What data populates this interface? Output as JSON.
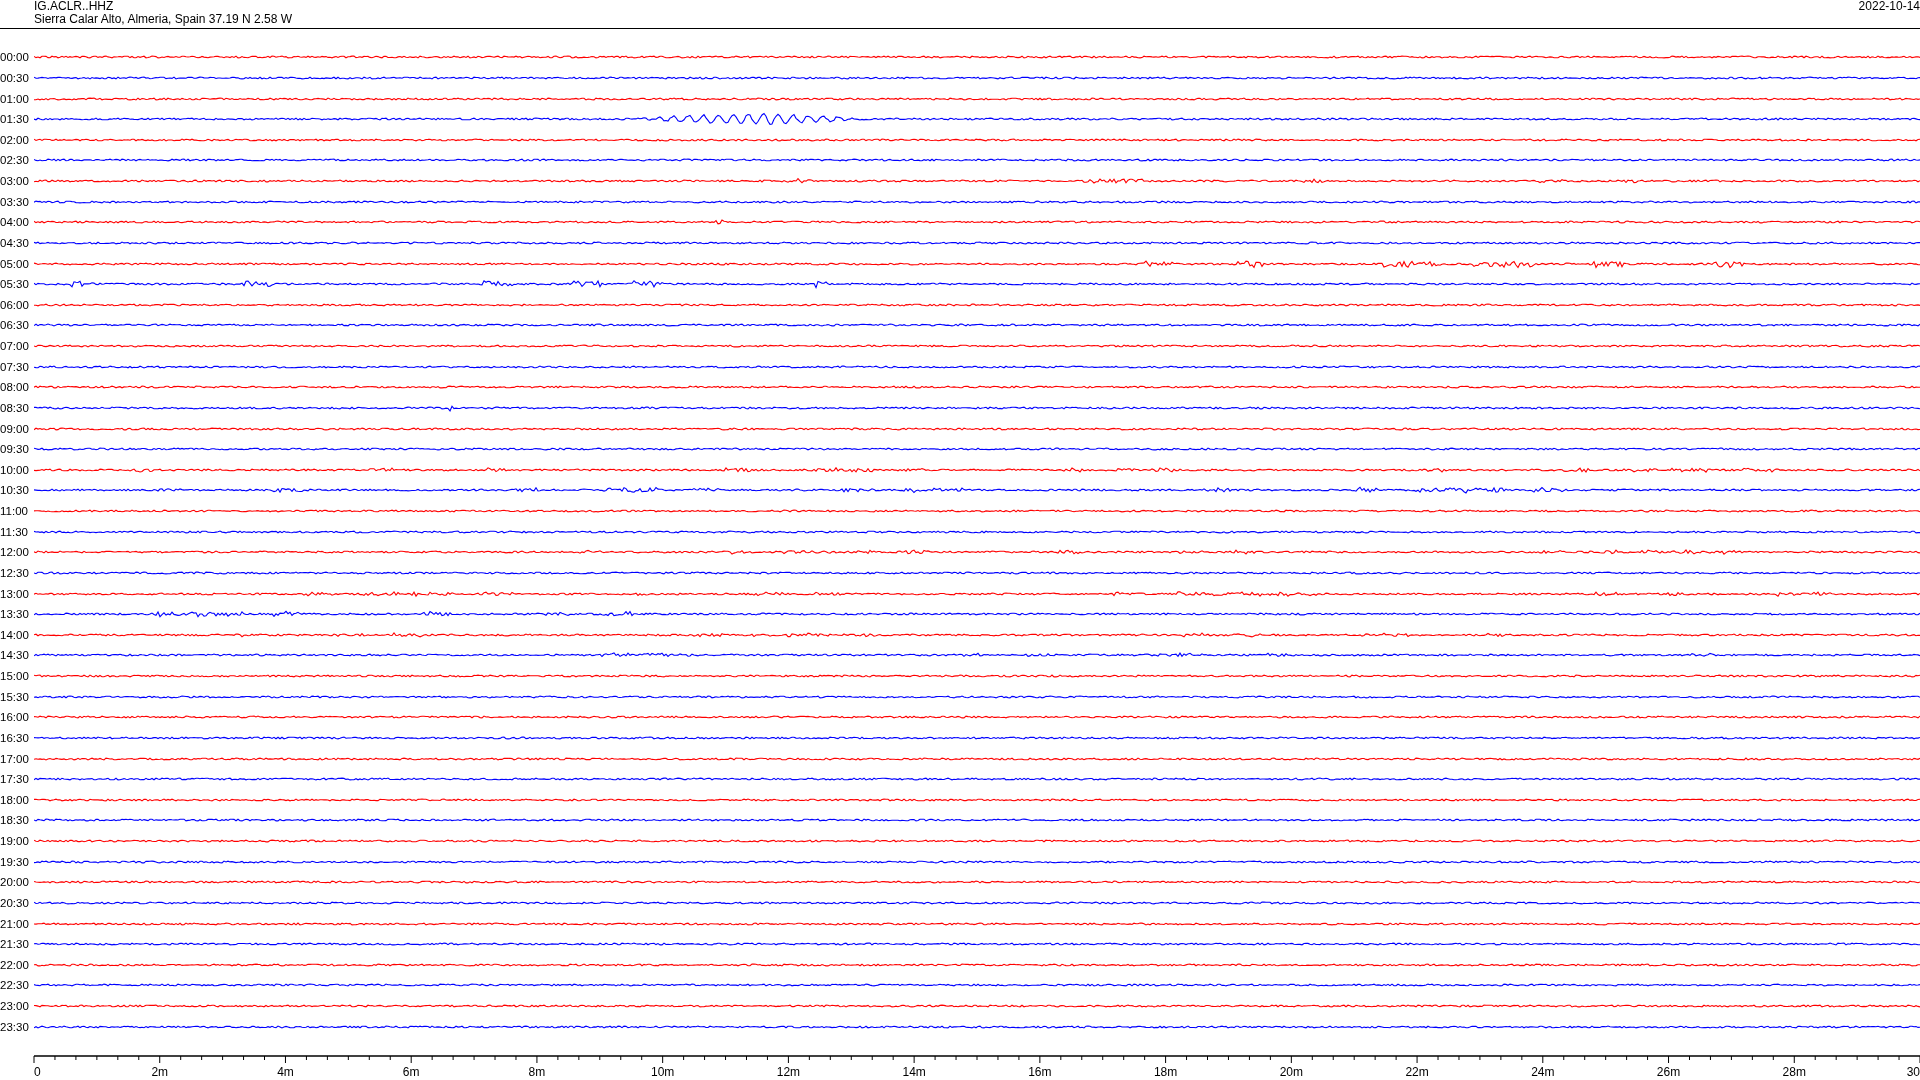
{
  "header": {
    "station": "IG.ACLR..HHZ",
    "location": "Sierra Calar Alto, Almeria, Spain  37.19 N 2.58 W",
    "date": "2022-10-14"
  },
  "rows": [
    {
      "label": "00:00",
      "color": "#ff0000"
    },
    {
      "label": "00:30",
      "color": "#0000ff"
    },
    {
      "label": "01:00",
      "color": "#ff0000"
    },
    {
      "label": "01:30",
      "color": "#0000ff"
    },
    {
      "label": "02:00",
      "color": "#ff0000"
    },
    {
      "label": "02:30",
      "color": "#0000ff"
    },
    {
      "label": "03:00",
      "color": "#ff0000"
    },
    {
      "label": "03:30",
      "color": "#0000ff"
    },
    {
      "label": "04:00",
      "color": "#ff0000"
    },
    {
      "label": "04:30",
      "color": "#0000ff"
    },
    {
      "label": "05:00",
      "color": "#ff0000"
    },
    {
      "label": "05:30",
      "color": "#0000ff"
    },
    {
      "label": "06:00",
      "color": "#ff0000"
    },
    {
      "label": "06:30",
      "color": "#0000ff"
    },
    {
      "label": "07:00",
      "color": "#ff0000"
    },
    {
      "label": "07:30",
      "color": "#0000ff"
    },
    {
      "label": "08:00",
      "color": "#ff0000"
    },
    {
      "label": "08:30",
      "color": "#0000ff"
    },
    {
      "label": "09:00",
      "color": "#ff0000"
    },
    {
      "label": "09:30",
      "color": "#0000ff"
    },
    {
      "label": "10:00",
      "color": "#ff0000"
    },
    {
      "label": "10:30",
      "color": "#0000ff"
    },
    {
      "label": "11:00",
      "color": "#ff0000"
    },
    {
      "label": "11:30",
      "color": "#0000ff"
    },
    {
      "label": "12:00",
      "color": "#ff0000"
    },
    {
      "label": "12:30",
      "color": "#0000ff"
    },
    {
      "label": "13:00",
      "color": "#ff0000"
    },
    {
      "label": "13:30",
      "color": "#0000ff"
    },
    {
      "label": "14:00",
      "color": "#ff0000"
    },
    {
      "label": "14:30",
      "color": "#0000ff"
    },
    {
      "label": "15:00",
      "color": "#ff0000"
    },
    {
      "label": "15:30",
      "color": "#0000ff"
    },
    {
      "label": "16:00",
      "color": "#ff0000"
    },
    {
      "label": "16:30",
      "color": "#0000ff"
    },
    {
      "label": "17:00",
      "color": "#ff0000"
    },
    {
      "label": "17:30",
      "color": "#0000ff"
    },
    {
      "label": "18:00",
      "color": "#ff0000"
    },
    {
      "label": "18:30",
      "color": "#0000ff"
    },
    {
      "label": "19:00",
      "color": "#ff0000"
    },
    {
      "label": "19:30",
      "color": "#0000ff"
    },
    {
      "label": "20:00",
      "color": "#ff0000"
    },
    {
      "label": "20:30",
      "color": "#0000ff"
    },
    {
      "label": "21:00",
      "color": "#ff0000"
    },
    {
      "label": "21:30",
      "color": "#0000ff"
    },
    {
      "label": "22:00",
      "color": "#ff0000"
    },
    {
      "label": "22:30",
      "color": "#0000ff"
    },
    {
      "label": "23:00",
      "color": "#ff0000"
    },
    {
      "label": "23:30",
      "color": "#0000ff"
    }
  ],
  "x_axis": {
    "ticks": [
      "0",
      "2m",
      "4m",
      "6m",
      "8m",
      "10m",
      "12m",
      "14m",
      "16m",
      "18m",
      "20m",
      "22m",
      "24m",
      "26m",
      "28m",
      "30"
    ]
  }
}
